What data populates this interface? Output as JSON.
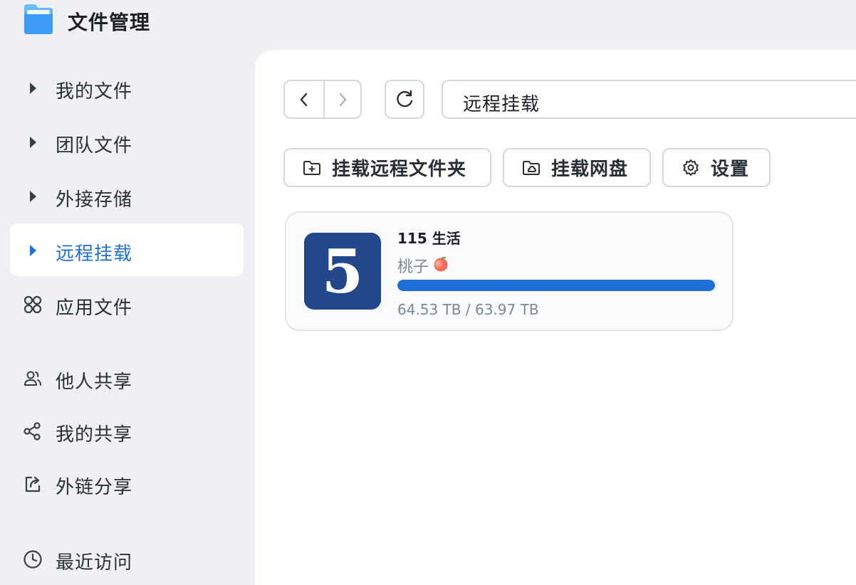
{
  "app": {
    "title": "文件管理",
    "logo_icon": "folder-icon"
  },
  "sidebar": {
    "items": [
      {
        "label": "我的文件",
        "icon": "triangle-right-icon",
        "active": false
      },
      {
        "label": "团队文件",
        "icon": "triangle-right-icon",
        "active": false
      },
      {
        "label": "外接存储",
        "icon": "triangle-right-icon",
        "active": false
      },
      {
        "label": "远程挂载",
        "icon": "triangle-right-icon",
        "active": true
      },
      {
        "label": "应用文件",
        "icon": "apps-icon",
        "active": false
      },
      {
        "label": "他人共享",
        "icon": "users-icon",
        "active": false
      },
      {
        "label": "我的共享",
        "icon": "share-icon",
        "active": false
      },
      {
        "label": "外链分享",
        "icon": "external-share-icon",
        "active": false
      },
      {
        "label": "最近访问",
        "icon": "clock-icon",
        "active": false
      }
    ]
  },
  "toolbar": {
    "back_icon": "chevron-left-icon",
    "forward_icon": "chevron-right-icon",
    "refresh_icon": "refresh-icon",
    "path": "远程挂载"
  },
  "actions": [
    {
      "label": "挂载远程文件夹",
      "icon": "folder-plus-icon"
    },
    {
      "label": "挂载网盘",
      "icon": "cloud-folder-icon"
    },
    {
      "label": "设置",
      "icon": "gear-icon"
    }
  ],
  "mount": {
    "name": "115 生活",
    "user": "桃子",
    "user_emoji": "peach-icon",
    "size_text": "64.53 TB / 63.97 TB",
    "usage_fraction": 1.0,
    "logo_glyph": "5",
    "logo_color": "#22478a"
  },
  "colors": {
    "accent": "#1f6fd9",
    "sidebar_bg": "#eef0f3",
    "panel_bg": "#ffffff"
  }
}
